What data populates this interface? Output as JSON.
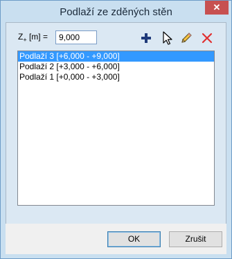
{
  "window": {
    "title": "Podlaží ze zděných stěn",
    "close_glyph": "✕"
  },
  "z_field": {
    "label_main": "Z",
    "label_sub": "+",
    "label_rest": " [m] =",
    "value": "9,000"
  },
  "toolbar": {
    "add_icon": "plus-icon",
    "select_icon": "pointer-icon",
    "edit_icon": "pencil-icon",
    "delete_icon": "delete-x-icon"
  },
  "list": {
    "items": [
      {
        "label": "Podlaží 3 [+6,000 - +9,000]",
        "selected": true
      },
      {
        "label": "Podlaží 2 [+3,000 - +6,000]",
        "selected": false
      },
      {
        "label": "Podlaží 1 [+0,000 - +3,000]",
        "selected": false
      }
    ]
  },
  "buttons": {
    "ok": "OK",
    "cancel": "Zrušit"
  },
  "colors": {
    "selection": "#3399ff",
    "add": "#1f3a7a",
    "delete": "#e03030"
  }
}
